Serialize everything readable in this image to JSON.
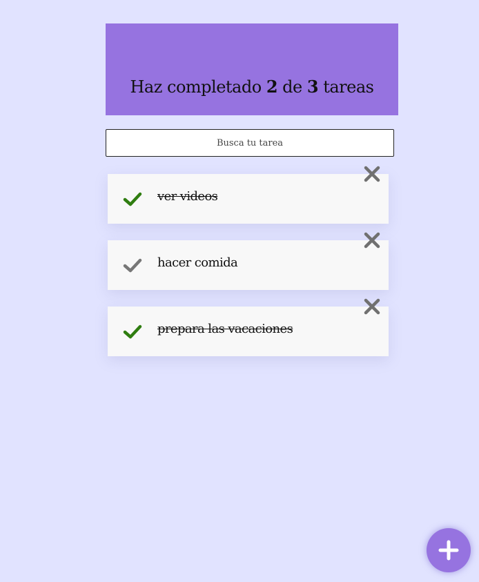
{
  "header": {
    "prefix": "Haz completado",
    "completed": "2",
    "middle": "de",
    "total": "3",
    "suffix": "tareas"
  },
  "search": {
    "placeholder": "Busca tu tarea",
    "value": ""
  },
  "todos": [
    {
      "text": "ver videos",
      "completed": true
    },
    {
      "text": "hacer comida",
      "completed": false
    },
    {
      "text": "prepara las vacaciones",
      "completed": true
    }
  ],
  "colors": {
    "background": "#e1e3ff",
    "header": "#9673e0",
    "check_completed": "#2f7d10",
    "check_pending": "#777777",
    "delete": "#707070",
    "fab": "#9673e0"
  },
  "icons": {
    "check": "check-icon",
    "delete": "close-icon",
    "add": "plus-icon"
  }
}
